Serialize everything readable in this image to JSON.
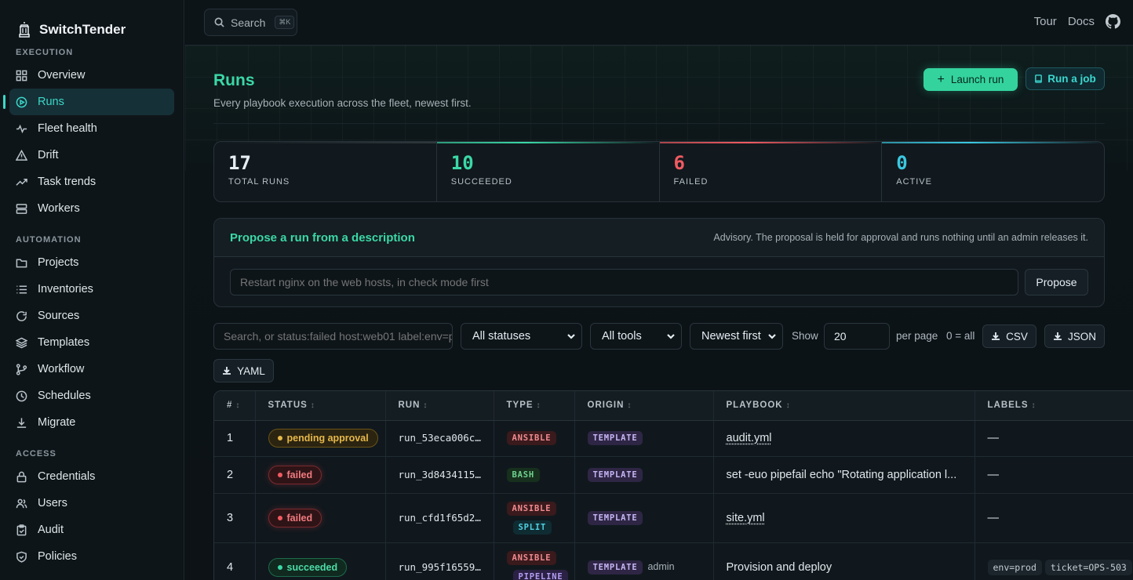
{
  "app": {
    "name": "SwitchTender"
  },
  "sidebar": {
    "sections": [
      {
        "title": "EXECUTION",
        "items": [
          {
            "label": "Overview",
            "icon": "grid-icon"
          },
          {
            "label": "Runs",
            "icon": "play-circle-icon",
            "active": true
          },
          {
            "label": "Fleet health",
            "icon": "pulse-icon"
          },
          {
            "label": "Drift",
            "icon": "warning-triangle-icon"
          },
          {
            "label": "Task trends",
            "icon": "trend-up-icon"
          },
          {
            "label": "Workers",
            "icon": "server-icon"
          }
        ]
      },
      {
        "title": "AUTOMATION",
        "items": [
          {
            "label": "Projects",
            "icon": "folder-icon"
          },
          {
            "label": "Inventories",
            "icon": "list-icon"
          },
          {
            "label": "Sources",
            "icon": "refresh-icon"
          },
          {
            "label": "Templates",
            "icon": "layers-icon"
          },
          {
            "label": "Workflow",
            "icon": "workflow-icon"
          },
          {
            "label": "Schedules",
            "icon": "clock-icon"
          },
          {
            "label": "Migrate",
            "icon": "download-icon"
          }
        ]
      },
      {
        "title": "ACCESS",
        "items": [
          {
            "label": "Credentials",
            "icon": "lock-icon"
          },
          {
            "label": "Users",
            "icon": "users-icon"
          },
          {
            "label": "Audit",
            "icon": "clipboard-icon"
          },
          {
            "label": "Policies",
            "icon": "shield-icon"
          }
        ]
      }
    ]
  },
  "topbar": {
    "search_label": "Search",
    "search_shortcut": "⌘K",
    "links": [
      "Tour",
      "Docs"
    ]
  },
  "page": {
    "title": "Runs",
    "subtitle": "Every playbook execution across the fleet, newest first.",
    "launch_label": "Launch run",
    "job_label": "Run a job"
  },
  "stats": [
    {
      "value": "17",
      "label": "TOTAL RUNS",
      "color": "#e6edf3"
    },
    {
      "value": "10",
      "label": "SUCCEEDED",
      "color": "#3bd8a6"
    },
    {
      "value": "6",
      "label": "FAILED",
      "color": "#f15a61"
    },
    {
      "value": "0",
      "label": "ACTIVE",
      "color": "#3bc8e0"
    }
  ],
  "propose": {
    "title": "Propose a run from a description",
    "note": "Advisory. The proposal is held for approval and runs nothing until an admin releases it.",
    "placeholder": "Restart nginx on the web hosts, in check mode first",
    "button": "Propose"
  },
  "filters": {
    "search_placeholder": "Search, or status:failed host:web01 label:env=prod",
    "status": "All statuses",
    "tool": "All tools",
    "sort": "Newest first",
    "show_label": "Show",
    "per_page_value": "20",
    "per_page_label": "per page",
    "all_hint": "0 = all",
    "csv": "CSV",
    "json": "JSON",
    "yaml": "YAML"
  },
  "table": {
    "headers": [
      "#",
      "STATUS",
      "RUN",
      "TYPE",
      "ORIGIN",
      "PLAYBOOK",
      "LABELS"
    ],
    "rows": [
      {
        "num": "1",
        "status": "pending approval",
        "status_kind": "pending",
        "run": "run_53eca006c…",
        "types": [
          "ANSIBLE"
        ],
        "origin": "TEMPLATE",
        "origin_user": "",
        "playbook": "audit.yml",
        "playbook_link": true,
        "labels": [
          "—"
        ]
      },
      {
        "num": "2",
        "status": "failed",
        "status_kind": "failed",
        "run": "run_3d8434115…",
        "types": [
          "BASH"
        ],
        "origin": "TEMPLATE",
        "origin_user": "",
        "playbook": "set -euo pipefail echo \"Rotating application l...",
        "playbook_link": false,
        "labels": [
          "—"
        ]
      },
      {
        "num": "3",
        "status": "failed",
        "status_kind": "failed",
        "run": "run_cfd1f65d2…",
        "types": [
          "ANSIBLE",
          "SPLIT"
        ],
        "origin": "TEMPLATE",
        "origin_user": "",
        "playbook": "site.yml",
        "playbook_link": true,
        "labels": [
          "—"
        ]
      },
      {
        "num": "4",
        "status": "succeeded",
        "status_kind": "success",
        "run": "run_995f16559…",
        "types": [
          "ANSIBLE",
          "PIPELINE"
        ],
        "origin": "TEMPLATE",
        "origin_user": "admin",
        "playbook": "Provision and deploy",
        "playbook_link": false,
        "labels": [
          "env=prod",
          "ticket=OPS-503"
        ]
      }
    ]
  }
}
